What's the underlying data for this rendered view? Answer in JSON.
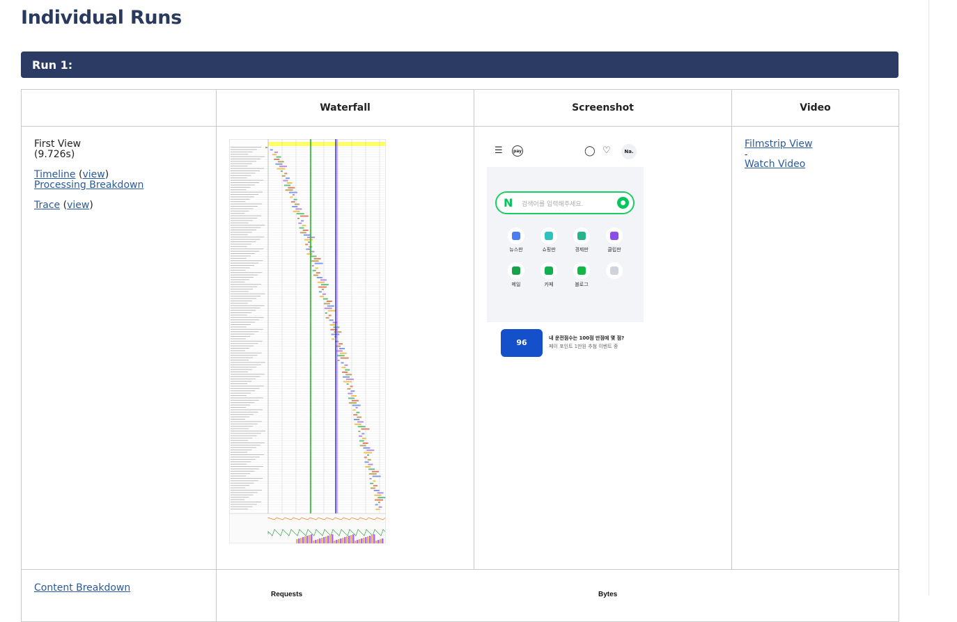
{
  "page": {
    "title": "Individual Runs"
  },
  "run": {
    "header": "Run 1:"
  },
  "table": {
    "columns": [
      "",
      "Waterfall",
      "Screenshot",
      "Video"
    ]
  },
  "first_view": {
    "label": "First View",
    "time": "(9.726s)",
    "timeline": "Timeline",
    "timeline_view": "view",
    "processing": "Processing Breakdown",
    "trace": "Trace",
    "trace_view": "view"
  },
  "video": {
    "filmstrip": "Filmstrip View",
    "separator": "-",
    "watch": "Watch Video"
  },
  "content": {
    "breakdown": "Content Breakdown",
    "requests_label": "Requests",
    "bytes_label": "Bytes"
  },
  "screenshot": {
    "nav_left_icons": [
      "menu-icon",
      "pay-icon"
    ],
    "pay_text": "pay",
    "nav_right_icons": [
      "chat-icon",
      "bell-icon"
    ],
    "account": "Na.",
    "search_logo": "N",
    "search_placeholder": "검색어를 입력해주세요.",
    "tiles": [
      {
        "label": "뉴스판",
        "color": "#4b7cf0"
      },
      {
        "label": "쇼핑판",
        "color": "#2fc0c0"
      },
      {
        "label": "경제판",
        "color": "#28b38a"
      },
      {
        "label": "클립판",
        "color": "#8a4ee8"
      },
      {
        "label": "메일",
        "color": "#17a34a"
      },
      {
        "label": "카페",
        "color": "#10b050"
      },
      {
        "label": "블로그",
        "color": "#12b847"
      },
      {
        "label": "",
        "color": "#cfd3da"
      }
    ],
    "banner_line1": "내 운전점수는 100점 만점에 몇 점?",
    "banner_line2": "페이 포인트 1만원 추첨 이벤트 중",
    "banner_badge": "96"
  },
  "colors": {
    "header_bg": "#2b3b63",
    "title": "#2a3a5e",
    "link": "#2a5a9e",
    "start_render_line": "#28b828",
    "onload_line": "#2222cc"
  }
}
